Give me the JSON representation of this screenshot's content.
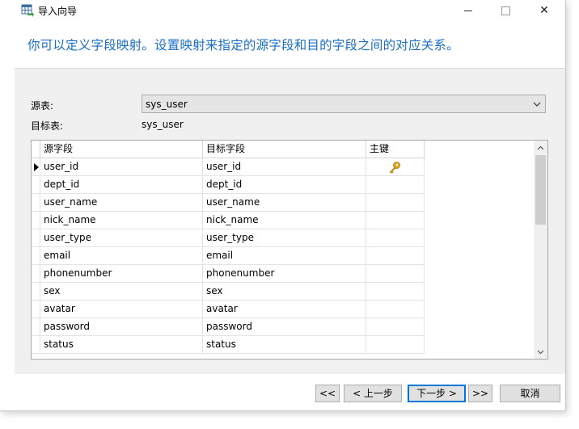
{
  "window": {
    "title": "导入向导",
    "close_glyph": "✕"
  },
  "heading": "你可以定义字段映射。设置映射来指定的源字段和目的字段之间的对应关系。",
  "form": {
    "source_label": "源表:",
    "source_value": "sys_user",
    "target_label": "目标表:",
    "target_value": "sys_user"
  },
  "grid": {
    "columns": [
      "源字段",
      "目标字段",
      "主键"
    ],
    "rows": [
      {
        "source": "user_id",
        "target": "user_id",
        "key": true,
        "current": true
      },
      {
        "source": "dept_id",
        "target": "dept_id",
        "key": false,
        "current": false
      },
      {
        "source": "user_name",
        "target": "user_name",
        "key": false,
        "current": false
      },
      {
        "source": "nick_name",
        "target": "nick_name",
        "key": false,
        "current": false
      },
      {
        "source": "user_type",
        "target": "user_type",
        "key": false,
        "current": false
      },
      {
        "source": "email",
        "target": "email",
        "key": false,
        "current": false
      },
      {
        "source": "phonenumber",
        "target": "phonenumber",
        "key": false,
        "current": false
      },
      {
        "source": "sex",
        "target": "sex",
        "key": false,
        "current": false
      },
      {
        "source": "avatar",
        "target": "avatar",
        "key": false,
        "current": false
      },
      {
        "source": "password",
        "target": "password",
        "key": false,
        "current": false
      },
      {
        "source": "status",
        "target": "status",
        "key": false,
        "current": false
      }
    ]
  },
  "buttons": {
    "first": "<<",
    "prev": "< 上一步",
    "next": "下一步 >",
    "last": ">>",
    "cancel": "取消"
  },
  "colors": {
    "heading": "#1a6fc4",
    "key_icon": "#e0a820",
    "primary_border": "#0078d7"
  }
}
